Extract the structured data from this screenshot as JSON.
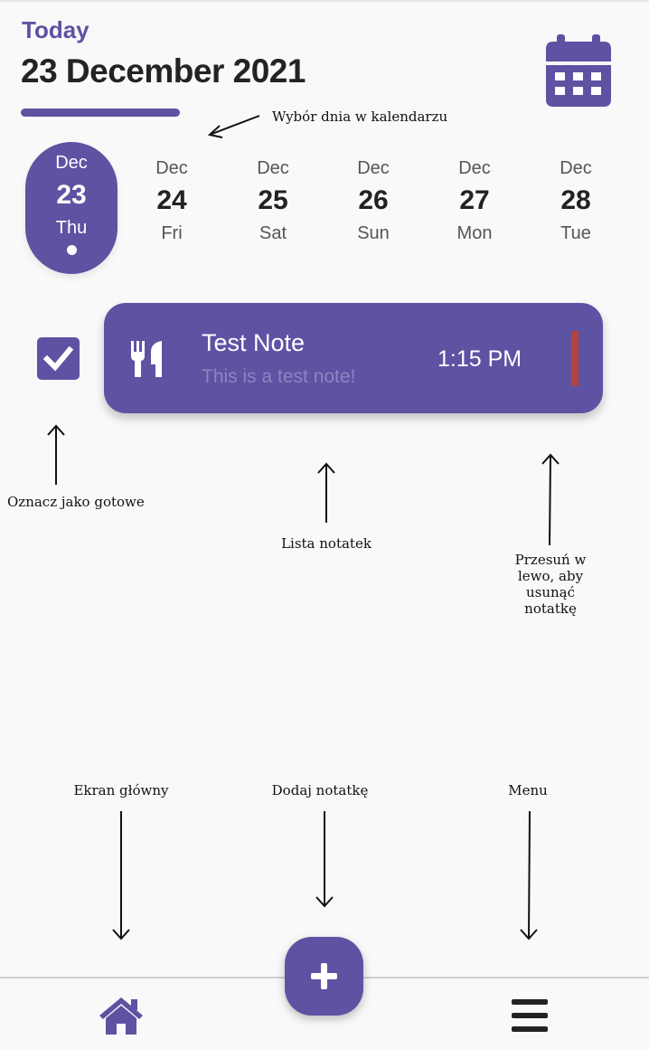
{
  "header": {
    "label": "Today",
    "date": "23 December 2021"
  },
  "days": [
    {
      "month": "Dec",
      "day": "23",
      "weekday": "Thu",
      "selected": true
    },
    {
      "month": "Dec",
      "day": "24",
      "weekday": "Fri"
    },
    {
      "month": "Dec",
      "day": "25",
      "weekday": "Sat"
    },
    {
      "month": "Dec",
      "day": "26",
      "weekday": "Sun"
    },
    {
      "month": "Dec",
      "day": "27",
      "weekday": "Mon"
    },
    {
      "month": "Dec",
      "day": "28",
      "weekday": "Tue"
    }
  ],
  "note": {
    "title": "Test Note",
    "body": "This is a test note!",
    "time": "1:15 PM",
    "done": true,
    "icon": "cutlery-icon",
    "tag_color": "#b2443f"
  },
  "annotations": {
    "calendar": "Wybór dnia w kalendarzu",
    "mark_done": "Oznacz jako gotowe",
    "notes_list": "Lista notatek",
    "swipe_delete": "Przesuń w lewo, aby usunąć notatkę",
    "home": "Ekran główny",
    "add_note": "Dodaj notatkę",
    "menu": "Menu"
  },
  "nav": {
    "home_icon": "home-icon",
    "add_icon": "plus-icon",
    "menu_icon": "hamburger-menu-icon"
  },
  "colors": {
    "accent": "#5e52a3",
    "background": "#f9f9f9",
    "text": "#232323"
  }
}
